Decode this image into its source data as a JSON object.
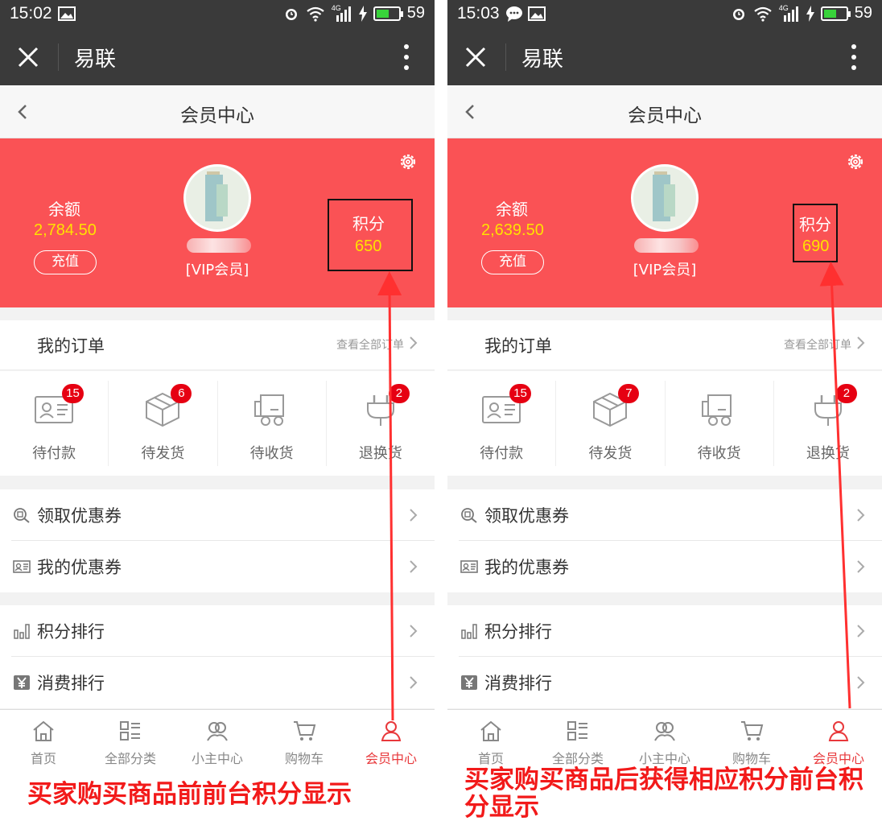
{
  "phones": [
    {
      "status": {
        "time": "15:02",
        "network": "4G",
        "battery": "59"
      },
      "app_title": "易联",
      "nav_title": "会员中心",
      "balance_label": "余额",
      "balance_value": "2,784.50",
      "recharge_label": "充值",
      "vip_label": "[VIP会员]",
      "points_label": "积分",
      "points_value": "650",
      "orders": {
        "title": "我的订单",
        "view_all": "查看全部订单"
      },
      "order_statuses": [
        {
          "label": "待付款",
          "badge": "15",
          "icon": "payment-card-icon"
        },
        {
          "label": "待发货",
          "badge": "6",
          "icon": "box-icon"
        },
        {
          "label": "待收货",
          "badge": "",
          "icon": "truck-icon"
        },
        {
          "label": "退换货",
          "badge": "2",
          "icon": "plug-icon"
        }
      ],
      "menu_group_1": [
        {
          "label": "领取优惠券",
          "icon": "coupon-search-icon"
        },
        {
          "label": "我的优惠券",
          "icon": "coupon-card-icon"
        }
      ],
      "menu_group_2": [
        {
          "label": "积分排行",
          "icon": "bar-chart-icon"
        },
        {
          "label": "消费排行",
          "icon": "yen-icon"
        }
      ],
      "tabs": [
        {
          "label": "首页",
          "icon": "home-icon",
          "active": false
        },
        {
          "label": "全部分类",
          "icon": "category-icon",
          "active": false
        },
        {
          "label": "小主中心",
          "icon": "users-icon",
          "active": false
        },
        {
          "label": "购物车",
          "icon": "cart-icon",
          "active": false
        },
        {
          "label": "会员中心",
          "icon": "member-icon",
          "active": true
        }
      ]
    },
    {
      "status": {
        "time": "15:03",
        "network": "4G",
        "battery": "59"
      },
      "app_title": "易联",
      "nav_title": "会员中心",
      "balance_label": "余额",
      "balance_value": "2,639.50",
      "recharge_label": "充值",
      "vip_label": "[VIP会员]",
      "points_label": "积分",
      "points_value": "690",
      "orders": {
        "title": "我的订单",
        "view_all": "查看全部订单"
      },
      "order_statuses": [
        {
          "label": "待付款",
          "badge": "15",
          "icon": "payment-card-icon"
        },
        {
          "label": "待发货",
          "badge": "7",
          "icon": "box-icon"
        },
        {
          "label": "待收货",
          "badge": "",
          "icon": "truck-icon"
        },
        {
          "label": "退换货",
          "badge": "2",
          "icon": "plug-icon"
        }
      ],
      "menu_group_1": [
        {
          "label": "领取优惠券",
          "icon": "coupon-search-icon"
        },
        {
          "label": "我的优惠券",
          "icon": "coupon-card-icon"
        }
      ],
      "menu_group_2": [
        {
          "label": "积分排行",
          "icon": "bar-chart-icon"
        },
        {
          "label": "消费排行",
          "icon": "yen-icon"
        }
      ],
      "tabs": [
        {
          "label": "首页",
          "icon": "home-icon",
          "active": false
        },
        {
          "label": "全部分类",
          "icon": "category-icon",
          "active": false
        },
        {
          "label": "小主中心",
          "icon": "users-icon",
          "active": false
        },
        {
          "label": "购物车",
          "icon": "cart-icon",
          "active": false
        },
        {
          "label": "会员中心",
          "icon": "member-icon",
          "active": true
        }
      ]
    }
  ],
  "captions": {
    "left": "买家购买商品前前台积分显示",
    "right": "买家购买商品后获得相应积分前台积分显示"
  },
  "colors": {
    "hero": "#fa5255",
    "accent": "#e8383b",
    "badge": "#e60012",
    "points": "#ffe100",
    "caption": "#f21a1a",
    "topbar": "#3a3a3a"
  }
}
